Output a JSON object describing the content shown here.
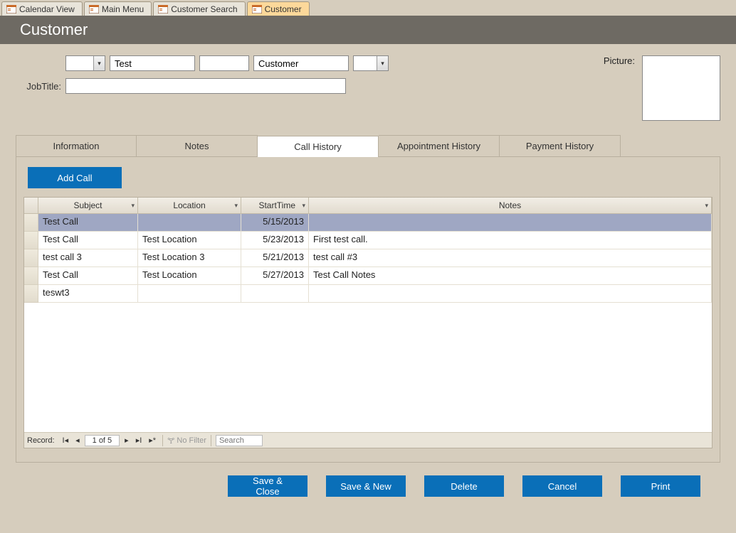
{
  "top_tabs": [
    {
      "label": "Calendar View"
    },
    {
      "label": "Main Menu"
    },
    {
      "label": "Customer Search"
    },
    {
      "label": "Customer",
      "active": true
    }
  ],
  "header": {
    "title": "Customer"
  },
  "form": {
    "prefix_combo_value": "",
    "first_name": "Test",
    "middle_name": "",
    "last_name": "Customer",
    "suffix_combo_value": "",
    "jobtitle_label": "JobTitle:",
    "jobtitle_value": "",
    "picture_label": "Picture:"
  },
  "sub_tabs": {
    "information": "Information",
    "notes": "Notes",
    "call_history": "Call History",
    "appointment_history": "Appointment History",
    "payment_history": "Payment History",
    "active": "call_history"
  },
  "buttons": {
    "add_call": "Add Call",
    "save_close": "Save & Close",
    "save_new": "Save & New",
    "delete": "Delete",
    "cancel": "Cancel",
    "print": "Print"
  },
  "grid": {
    "headers": {
      "subject": "Subject",
      "location": "Location",
      "start": "StartTime",
      "notes": "Notes"
    },
    "rows": [
      {
        "subject": "Test Call",
        "location": "",
        "start": "5/15/2013",
        "notes": "",
        "selected": true
      },
      {
        "subject": "Test Call",
        "location": "Test Location",
        "start": "5/23/2013",
        "notes": "First test call."
      },
      {
        "subject": "test call 3",
        "location": "Test Location 3",
        "start": "5/21/2013",
        "notes": "test call #3"
      },
      {
        "subject": "Test Call",
        "location": "Test Location",
        "start": "5/27/2013",
        "notes": "Test Call Notes"
      },
      {
        "subject": "teswt3",
        "location": "",
        "start": "",
        "notes": ""
      }
    ]
  },
  "record_nav": {
    "label": "Record:",
    "counter": "1 of 5",
    "no_filter": "No Filter",
    "search_placeholder": "Search"
  }
}
